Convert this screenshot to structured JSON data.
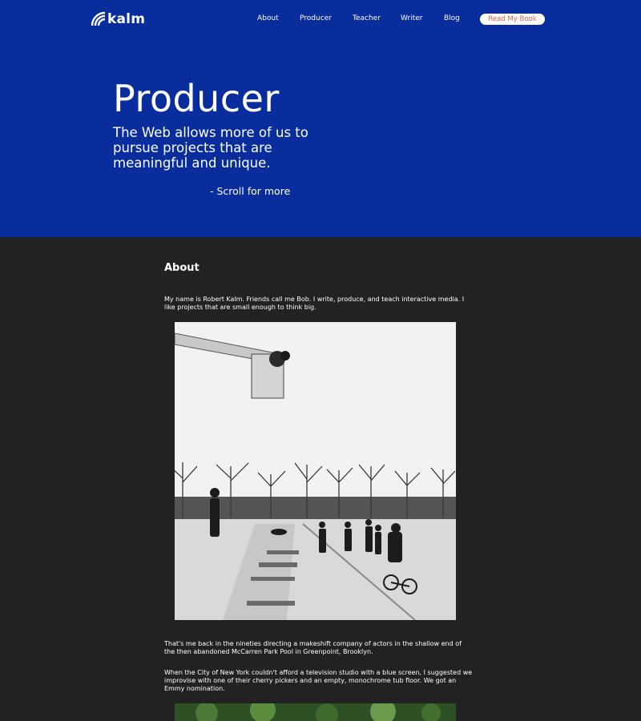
{
  "brand": {
    "name": "kalm"
  },
  "nav": {
    "items": [
      {
        "label": "About"
      },
      {
        "label": "Producer"
      },
      {
        "label": "Teacher"
      },
      {
        "label": "Writer"
      },
      {
        "label": "Blog"
      }
    ],
    "cta_label": "Read My Book"
  },
  "hero": {
    "title": "Producer",
    "subtitle": "The Web allows more of us to pursue projects that are meaningful and unique.",
    "scroll_hint": "- Scroll for more"
  },
  "about": {
    "title": "About",
    "intro": "My name is Robert Kalm. Friends call me Bob. I write, produce, and teach interactive media. I like projects that are small enough to think big.",
    "caption": "That's me back in the nineties directing a makeshift company of actors in the shallow end of the then abandoned McCarren Park Pool in Greenpoint, Brooklyn.",
    "story": "When the City of New York couldn't afford a television studio with a blue screen, I suggested we improvise with one of their cherry pickers and an empty, monochrome tub floor. We got an Emmy nomination."
  },
  "colors": {
    "hero_bg": "#0a2d9e",
    "page_bg": "#222222",
    "cta_text": "#d9624a"
  }
}
